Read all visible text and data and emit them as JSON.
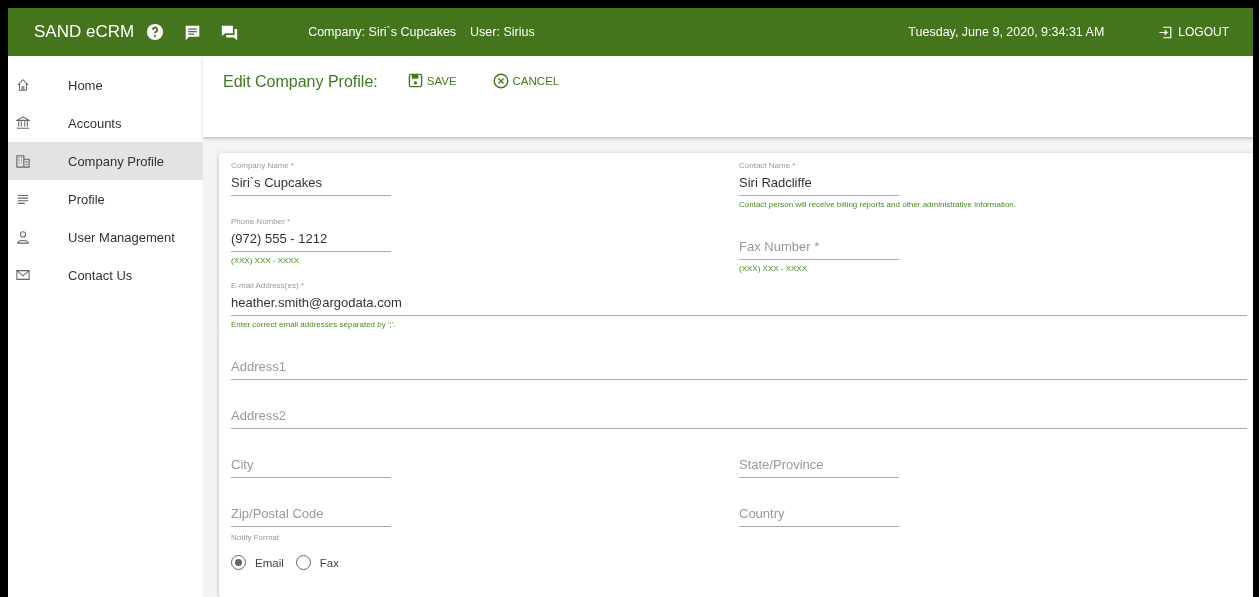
{
  "header": {
    "app_name": "SAND eCRM",
    "company": "Company: Siri`s Cupcakes",
    "user": "User: Sirius",
    "datetime": "Tuesday, June 9, 2020, 9:34:31 AM",
    "logout": "LOGOUT"
  },
  "sidebar": {
    "items": [
      {
        "label": "Home",
        "selected": false
      },
      {
        "label": "Accounts",
        "selected": false
      },
      {
        "label": "Company Profile",
        "selected": true
      },
      {
        "label": "Profile",
        "selected": false
      },
      {
        "label": "User Management",
        "selected": false
      },
      {
        "label": "Contact Us",
        "selected": false
      }
    ]
  },
  "page": {
    "title": "Edit Company Profile:",
    "save": "SAVE",
    "cancel": "CANCEL"
  },
  "form": {
    "rows": [
      [
        {
          "kind": "short",
          "label": "Company Name *",
          "value": "Siri`s Cupcakes"
        },
        {
          "kind": "short",
          "label": "Contact Name *",
          "value": "Siri Radcliffe",
          "hint": "Contact person will receive billing reports and other administrative information."
        }
      ],
      [
        {
          "kind": "short",
          "label": "Phone Number *",
          "value": "(972) 555 - 1212",
          "hint": "(XXX) XXX - XXXX"
        },
        {
          "kind": "short",
          "placeholder": "Fax Number *",
          "hint": "(XXX) XXX - XXXX"
        }
      ],
      [
        {
          "kind": "wide",
          "label": "E-mail Address(es) *",
          "value": "heather.smith@argodata.com",
          "hint": "Enter correct email addresses separated by ';'."
        }
      ],
      [
        {
          "kind": "wide",
          "placeholder": "Address1"
        }
      ],
      [
        {
          "kind": "wide",
          "placeholder": "Address2"
        }
      ],
      [
        {
          "kind": "short",
          "placeholder": "City"
        },
        {
          "kind": "short",
          "placeholder": "State/Province"
        }
      ],
      [
        {
          "kind": "short",
          "placeholder": "Zip/Postal Code"
        },
        {
          "kind": "short",
          "placeholder": "Country"
        }
      ]
    ],
    "notify": {
      "label": "Notify Format",
      "options": [
        {
          "label": "Email",
          "selected": true
        },
        {
          "label": "Fax",
          "selected": false
        }
      ]
    }
  }
}
